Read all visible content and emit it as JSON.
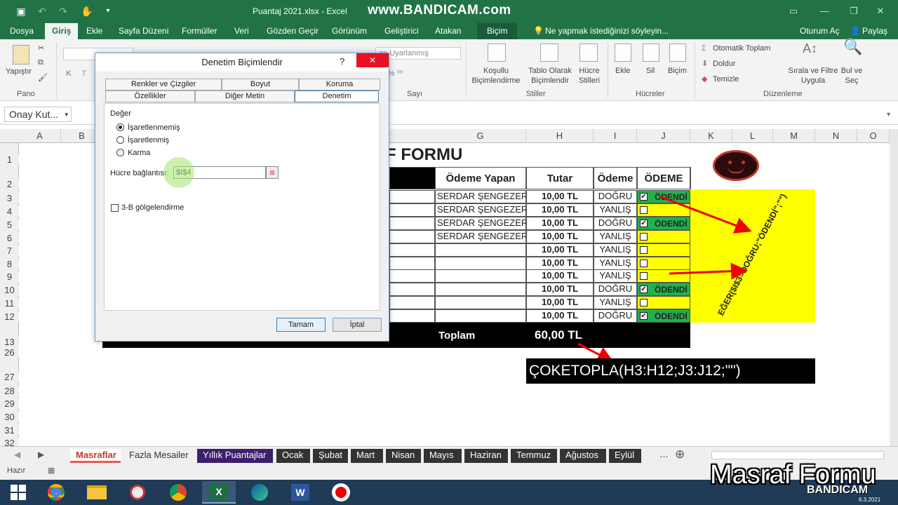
{
  "titlebar": {
    "file_title": "Puantaj 2021.xlsx - Excel",
    "watermark": "www.BANDICAM.com"
  },
  "tabs": [
    "Dosya",
    "Giriş",
    "Ekle",
    "Sayfa Düzeni",
    "Formüller",
    "Veri",
    "Gözden Geçir",
    "Görünüm",
    "Geliştirici",
    "Atakan",
    "Biçim"
  ],
  "tell_me": "Ne yapmak istediğinizi söyleyin...",
  "signin": "Oturum Aç",
  "share": "Paylaş",
  "ribbon": {
    "paste": "Yapıştır",
    "pano": "Pano",
    "number_format": "ge Uyarlanmış",
    "sayi": "Sayı",
    "cond_format": "Koşullu Biçimlendirme",
    "table_format": "Tablo Olarak Biçimlendir",
    "cell_styles": "Hücre Stilleri",
    "stiller": "Stiller",
    "insert": "Ekle",
    "delete": "Sil",
    "format": "Biçim",
    "hucreler": "Hücreler",
    "autosum": "Otomatik Toplam",
    "fill": "Doldur",
    "clear": "Temizle",
    "sort": "Sırala ve Filtre Uygula",
    "find": "Bul ve Seç",
    "duzenleme": "Düzenleme"
  },
  "namebox": "Onay Kut...",
  "columns": [
    "A",
    "B",
    "G",
    "H",
    "I",
    "J",
    "K",
    "L",
    "M",
    "N",
    "O"
  ],
  "rows": [
    "1",
    "2",
    "3",
    "4",
    "5",
    "6",
    "7",
    "8",
    "9",
    "10",
    "11",
    "12",
    "13",
    "26",
    "27",
    "28",
    "29",
    "30",
    "31",
    "32"
  ],
  "sheet": {
    "title": "F FORMU",
    "headers": {
      "payer": "Ödeme Yapan",
      "amount": "Tutar",
      "payment": "Ödeme",
      "paid": "ÖDEME"
    },
    "rows": [
      {
        "payer": "SERDAR ŞENGEZER",
        "amount": "10,00 TL",
        "status": "DOĞRU",
        "checked": true,
        "paid": "ÖDENDİ"
      },
      {
        "payer": "SERDAR ŞENGEZER",
        "amount": "10,00 TL",
        "status": "YANLIŞ",
        "checked": false,
        "paid": ""
      },
      {
        "payer": "SERDAR ŞENGEZER",
        "amount": "10,00 TL",
        "status": "DOĞRU",
        "checked": true,
        "paid": "ÖDENDİ"
      },
      {
        "payer": "SERDAR ŞENGEZER",
        "amount": "10,00 TL",
        "status": "YANLIŞ",
        "checked": false,
        "paid": ""
      },
      {
        "payer": "",
        "amount": "10,00 TL",
        "status": "YANLIŞ",
        "checked": false,
        "paid": ""
      },
      {
        "payer": "",
        "amount": "10,00 TL",
        "status": "YANLIŞ",
        "checked": false,
        "paid": ""
      },
      {
        "payer": "",
        "amount": "10,00 TL",
        "status": "YANLIŞ",
        "checked": false,
        "paid": ""
      },
      {
        "payer": "",
        "amount": "10,00 TL",
        "status": "DOĞRU",
        "checked": true,
        "paid": "ÖDENDİ"
      },
      {
        "payer": "",
        "amount": "10,00 TL",
        "status": "YANLIŞ",
        "checked": false,
        "paid": ""
      },
      {
        "payer": "",
        "amount": "10,00 TL",
        "status": "DOĞRU",
        "checked": true,
        "paid": "ÖDENDİ"
      }
    ],
    "total_label": "Toplam",
    "total_value": "60,00 TL",
    "formula_note": "EĞER($I$3=DOĞRU;\"ÖDENDİ\";\"\")",
    "sumif_note": "ÇOKETOPLA(H3:H12;J3:J12;\"\")"
  },
  "dialog": {
    "title": "Denetim Biçimlendir",
    "help": "?",
    "close": "✕",
    "tabs_row1": [
      "Renkler ve Çizgiler",
      "Boyut",
      "Koruma"
    ],
    "tabs_row2": [
      "Özellikler",
      "Diğer Metin",
      "Denetim"
    ],
    "value_group": "Değer",
    "radio_unchecked": "İşaretlenmemiş",
    "radio_checked": "İşaretlenmiş",
    "radio_mixed": "Karma",
    "link_label": "Hücre bağlantısı:",
    "link_value": "$I$4",
    "shading": "3-B gölgelendirme",
    "ok": "Tamam",
    "cancel": "İptal"
  },
  "sheet_tabs": [
    "Masraflar",
    "Fazla Mesailer",
    "Yıllık Puantajlar",
    "Ocak",
    "Şubat",
    "Mart",
    "Nisan",
    "Mayıs",
    "Haziran",
    "Temmuz",
    "Ağustos",
    "Eylül"
  ],
  "status": "Hazır",
  "overlay_caption": "Masraf Formu",
  "overlay_logo": "BANDICAM",
  "overlay_date": "6.3.2021"
}
